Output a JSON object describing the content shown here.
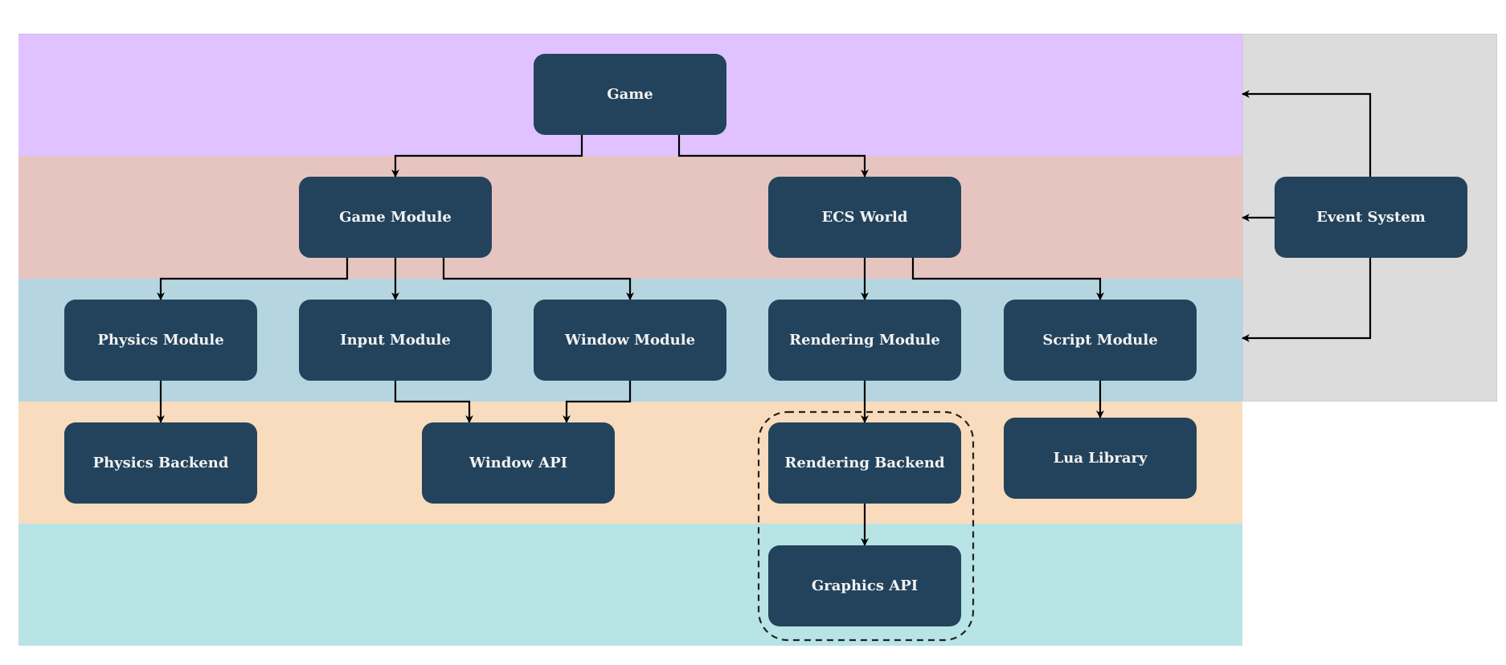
{
  "colors": {
    "node": "#23435c",
    "layer_1": "#dfc2ff",
    "layer_2": "#e6c5c1",
    "layer_3": "#b5d5e1",
    "layer_4": "#f9dcbd",
    "layer_5": "#b8e4e6",
    "side_panel": "#dcdcdc"
  },
  "nodes": {
    "game": "Game",
    "game_module": "Game Module",
    "ecs_world": "ECS World",
    "event_system": "Event System",
    "physics_module": "Physics Module",
    "input_module": "Input Module",
    "window_module": "Window Module",
    "rendering_module": "Rendering Module",
    "script_module": "Script Module",
    "physics_backend": "Physics Backend",
    "window_api": "Window API",
    "rendering_backend": "Rendering Backend",
    "lua_library": "Lua Library",
    "graphics_api": "Graphics API"
  },
  "edges": [
    [
      "game",
      "game_module"
    ],
    [
      "game",
      "ecs_world"
    ],
    [
      "game_module",
      "physics_module"
    ],
    [
      "game_module",
      "input_module"
    ],
    [
      "game_module",
      "window_module"
    ],
    [
      "ecs_world",
      "rendering_module"
    ],
    [
      "ecs_world",
      "script_module"
    ],
    [
      "physics_module",
      "physics_backend"
    ],
    [
      "input_module",
      "window_api"
    ],
    [
      "window_module",
      "window_api"
    ],
    [
      "rendering_module",
      "rendering_backend"
    ],
    [
      "rendering_backend",
      "graphics_api"
    ],
    [
      "script_module",
      "lua_library"
    ],
    [
      "event_system",
      "layer_1"
    ],
    [
      "event_system",
      "layer_2"
    ],
    [
      "event_system",
      "layer_3"
    ]
  ],
  "groups": [
    {
      "members": [
        "rendering_backend",
        "graphics_api"
      ],
      "style": "dashed"
    }
  ]
}
